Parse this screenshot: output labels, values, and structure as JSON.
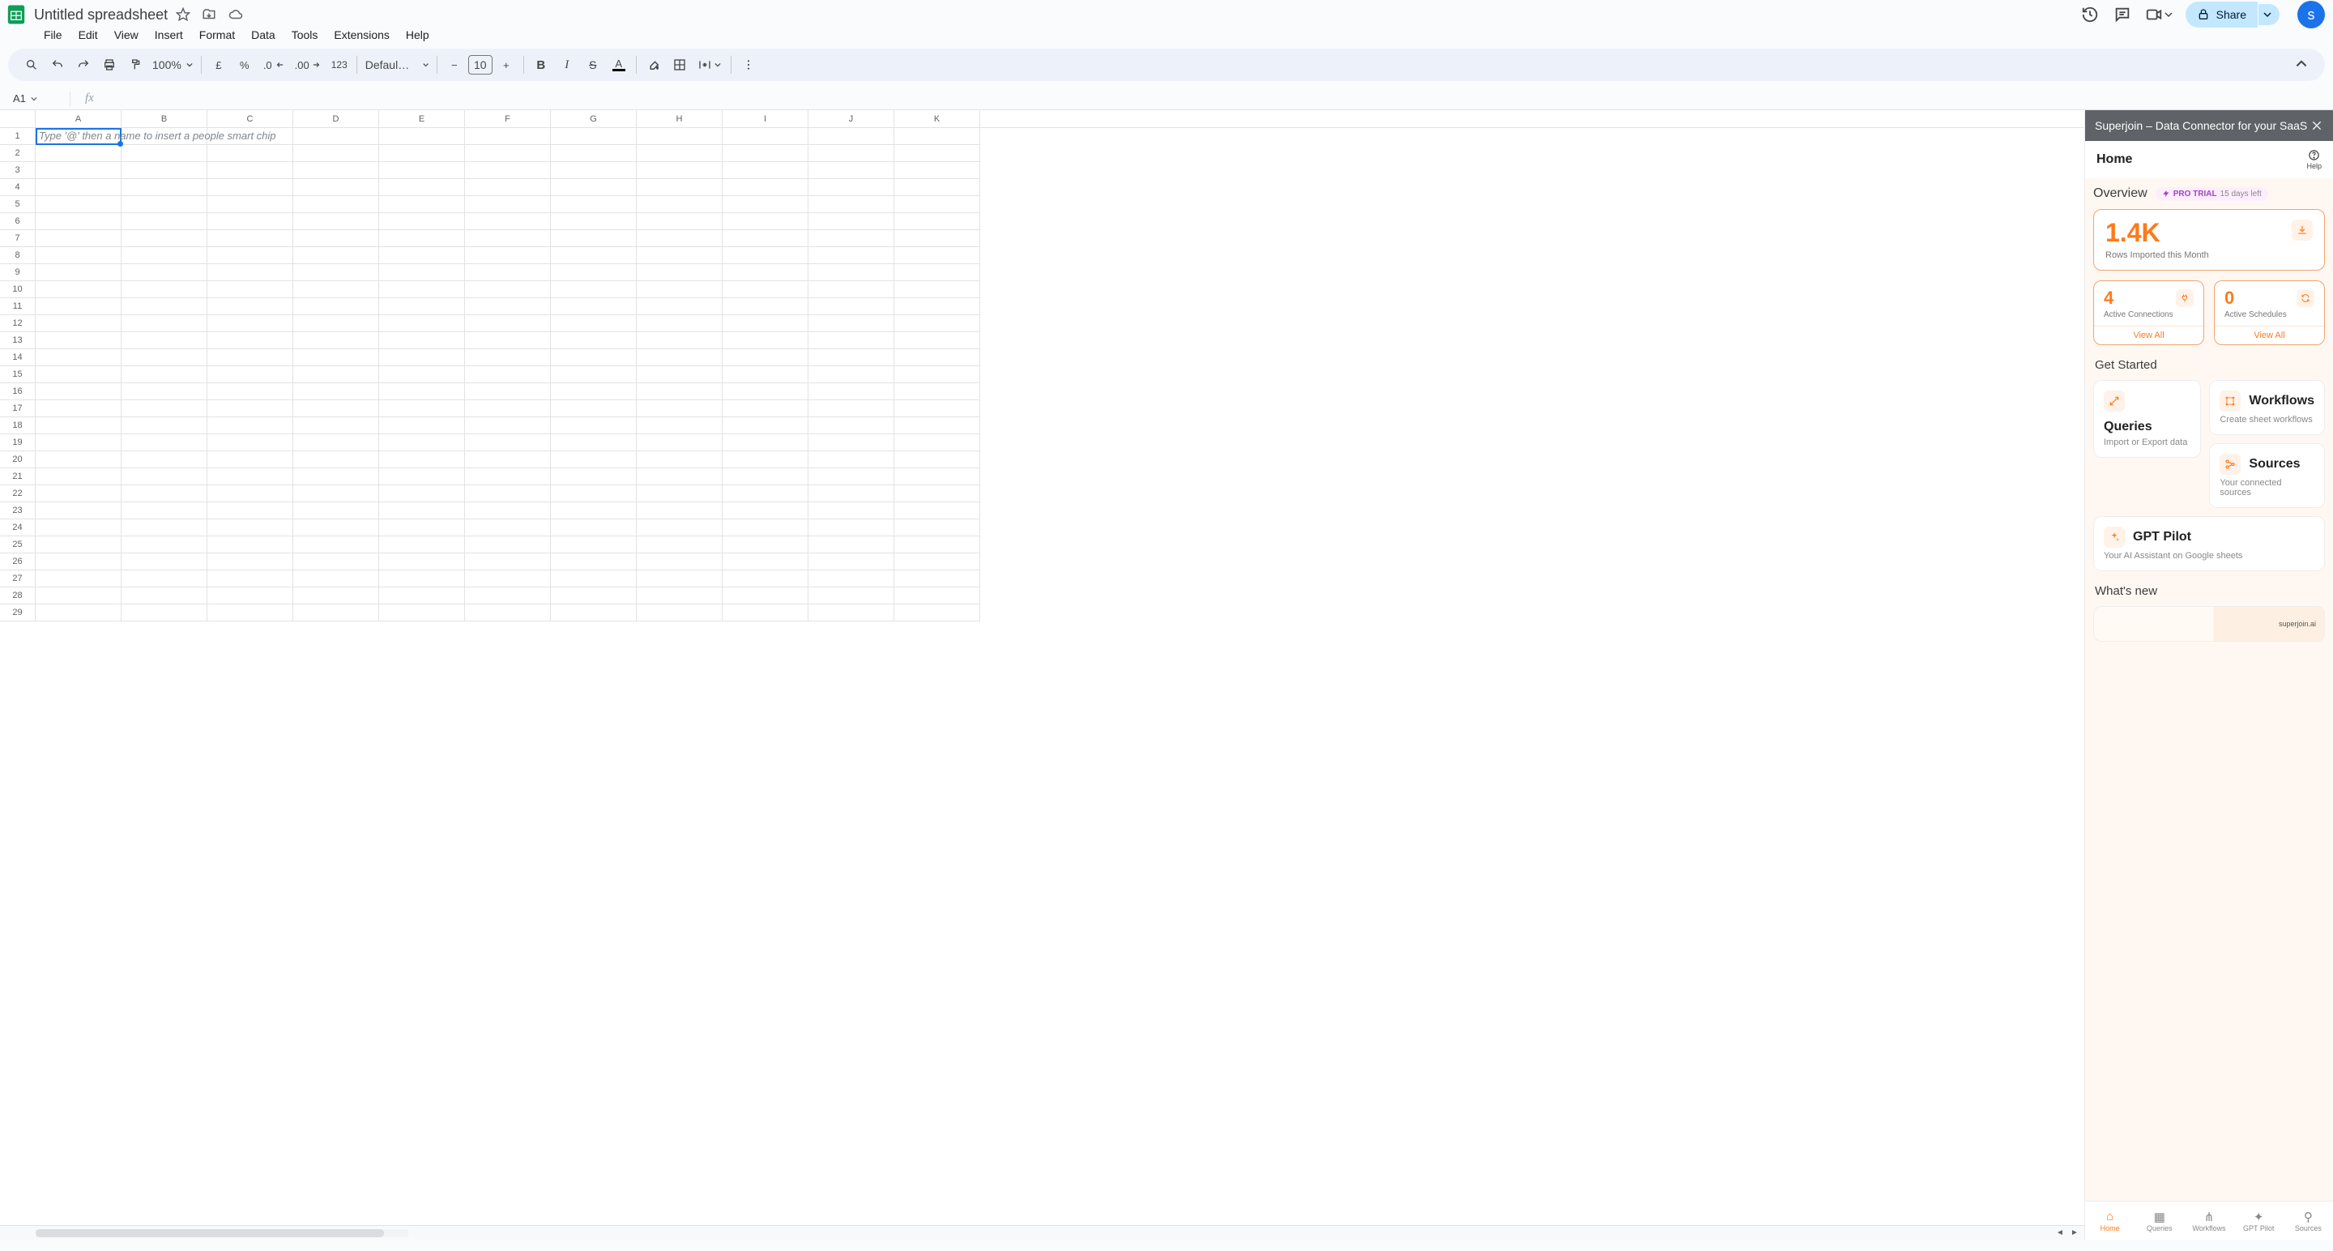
{
  "doc": {
    "title": "Untitled spreadsheet"
  },
  "menus": [
    "File",
    "Edit",
    "View",
    "Insert",
    "Format",
    "Data",
    "Tools",
    "Extensions",
    "Help"
  ],
  "toolbar": {
    "zoom": "100%",
    "currency": "£",
    "percent": "%",
    "dec_dec": ".0",
    "dec_inc": ".00",
    "num123": "123",
    "font_name": "Defaul…",
    "font_size": "10"
  },
  "share_label": "Share",
  "avatar_initial": "s",
  "name_box": "A1",
  "columns": [
    "A",
    "B",
    "C",
    "D",
    "E",
    "F",
    "G",
    "H",
    "I",
    "J",
    "K"
  ],
  "row_count": 29,
  "cell_placeholder": "Type '@' then a name to insert a people smart chip",
  "panel": {
    "title": "Superjoin – Data Connector for your SaaS",
    "sub_home": "Home",
    "help_label": "Help",
    "overview": {
      "title": "Overview",
      "trial_badge": "PRO TRIAL",
      "trial_days": "15 days left",
      "rows_imported_value": "1.4K",
      "rows_imported_label": "Rows Imported this Month",
      "connections_value": "4",
      "connections_label": "Active Connections",
      "schedules_value": "0",
      "schedules_label": "Active Schedules",
      "view_all": "View All"
    },
    "get_started": {
      "title": "Get Started",
      "queries_title": "Queries",
      "queries_desc": "Import or Export data",
      "workflows_title": "Workflows",
      "workflows_desc": "Create sheet workflows",
      "sources_title": "Sources",
      "sources_desc": "Your connected sources",
      "gpt_title": "GPT Pilot",
      "gpt_desc": "Your AI Assistant on Google sheets"
    },
    "whats_new": {
      "title": "What's new",
      "brand": "superjoin.ai"
    },
    "nav": [
      "Home",
      "Queries",
      "Workflows",
      "GPT Pilot",
      "Sources"
    ]
  }
}
